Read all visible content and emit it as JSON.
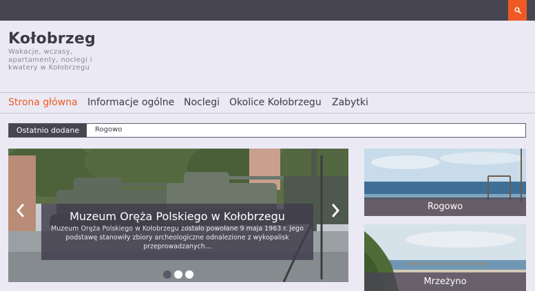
{
  "header": {
    "site_title": "Kołobrzeg",
    "site_description": "Wakacje, wczasy, apartamenty, noclegi i kwatery w Kołobrzegu",
    "search_icon": "search-icon"
  },
  "nav": {
    "items": [
      {
        "label": "Strona główna",
        "active": true
      },
      {
        "label": "Informacje ogólne",
        "active": false
      },
      {
        "label": "Noclegi",
        "active": false
      },
      {
        "label": "Okolice Kołobrzegu",
        "active": false
      },
      {
        "label": "Zabytki",
        "active": false
      }
    ]
  },
  "ticker": {
    "label": "Ostatnio dodane",
    "item": "Rogowo"
  },
  "slider": {
    "title": "Muzeum Oręża Polskiego w Kołobrzegu",
    "excerpt": "Muzeum Oręża Polskiego w Kołobrzegu zostało powołane 9 maja 1963 r. Jego podstawę stanowiły zbiory archeologiczne odnalezione z wykopalisk przeprowadzanych...",
    "prev_icon": "chevron-left-icon",
    "next_icon": "chevron-right-icon",
    "dots": [
      {
        "active": true
      },
      {
        "active": false
      },
      {
        "active": false
      }
    ]
  },
  "cards": [
    {
      "label": "Rogowo"
    },
    {
      "label": "Mrzeżyno"
    }
  ],
  "colors": {
    "accent": "#ef5a24",
    "topbar": "#474552",
    "background": "#ebe9f4",
    "text": "#3b3a45"
  }
}
